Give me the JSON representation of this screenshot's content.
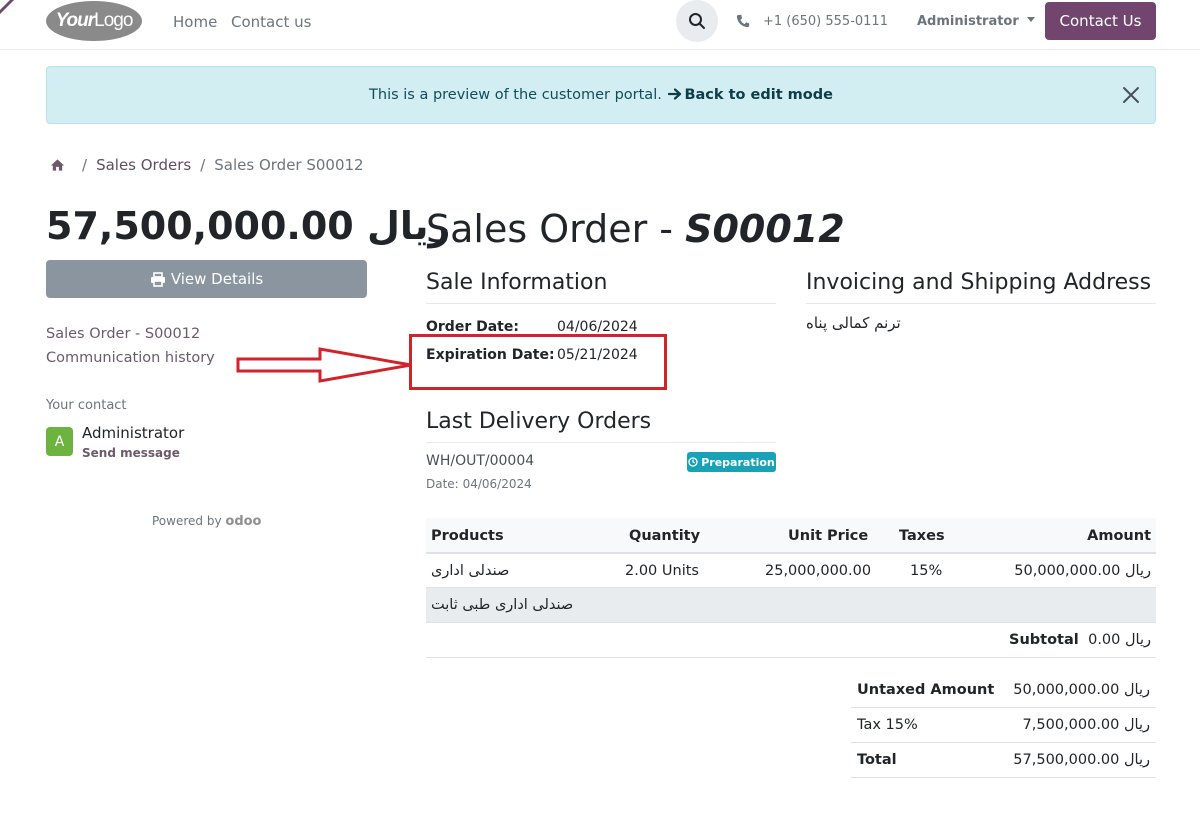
{
  "header": {
    "logo_your": "Your",
    "logo_logo": "Logo",
    "nav": [
      "Home",
      "Contact us"
    ],
    "phone": "+1 (650) 555-0111",
    "user": "Administrator",
    "contact_button": "Contact Us"
  },
  "alert": {
    "text": "This is a preview of the customer portal.",
    "link": "Back to edit mode"
  },
  "breadcrumb": {
    "sep": "/",
    "items": [
      "Sales Orders",
      "Sales Order S00012"
    ]
  },
  "sidebar": {
    "amount": "57,500,000.00 ریال",
    "view_details": "View Details",
    "links": [
      "Sales Order - S00012",
      "Communication history"
    ],
    "your_contact": "Your contact",
    "avatar_letter": "A",
    "contact_name": "Administrator",
    "send_message": "Send message",
    "powered_by": "Powered by",
    "odoo": "odoo"
  },
  "order": {
    "title_prefix": "Sales Order - ",
    "title_number": "S00012",
    "sale_info_heading": "Sale Information",
    "order_date_label": "Order Date:",
    "order_date": "04/06/2024",
    "expiration_label": "Expiration Date:",
    "expiration_date": "05/21/2024",
    "address_heading": "Invoicing and Shipping Address",
    "address_name": "ترنم کمالی پناه",
    "delivery_heading": "Last Delivery Orders",
    "delivery_ref": "WH/OUT/00004",
    "delivery_date_label": "Date:",
    "delivery_date": "04/06/2024",
    "delivery_status": "Preparation"
  },
  "table": {
    "headers": [
      "Products",
      "Quantity",
      "Unit Price",
      "Taxes",
      "Amount"
    ],
    "row": {
      "product": "صندلی اداری",
      "quantity": "2.00 Units",
      "unit_price": "25,000,000.00",
      "taxes": "15%",
      "amount": "50,000,000.00 ریال"
    },
    "section": "صندلی اداری طبی ثابت",
    "subtotal_label": "Subtotal",
    "subtotal_value": "0.00 ریال"
  },
  "totals": {
    "untaxed_label": "Untaxed Amount",
    "untaxed_value": "50,000,000.00 ریال",
    "tax_label": "Tax 15%",
    "tax_value": "7,500,000.00 ریال",
    "total_label": "Total",
    "total_value": "57,500,000.00 ریال"
  },
  "colors": {
    "brand": "#71456e",
    "alert_bg": "#d3eef3",
    "badge": "#17a2b8",
    "annotation_red": "#d0232a",
    "avatar": "#6cb33f"
  }
}
